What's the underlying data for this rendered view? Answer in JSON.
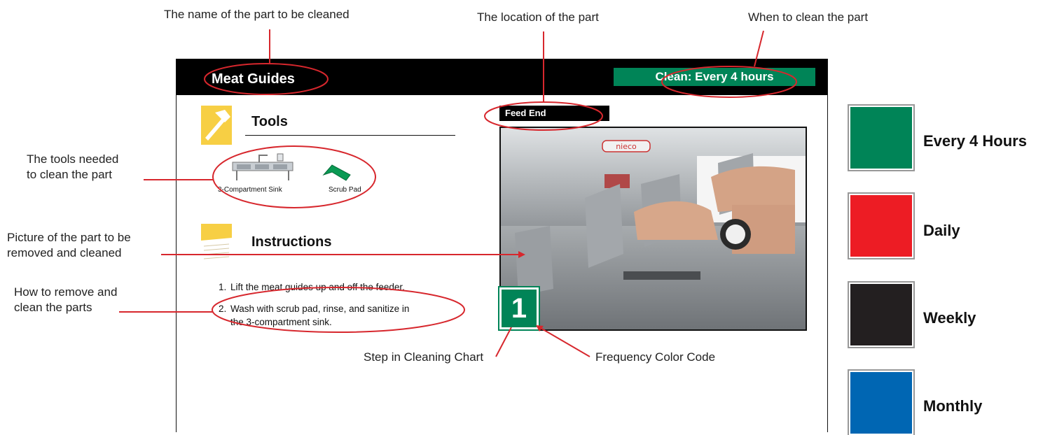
{
  "callouts": {
    "part_name": "The name of the part to be cleaned",
    "location": "The location of the part",
    "when": "When to clean the part",
    "tools_line1": "The tools needed",
    "tools_line2": "to clean the part",
    "picture_line1": "Picture of the part to be",
    "picture_line2": "removed and cleaned",
    "how_line1": "How to remove and",
    "how_line2": "clean the parts",
    "step": "Step in Cleaning Chart",
    "frequency": "Frequency Color Code"
  },
  "card": {
    "title": "Meat Guides",
    "frequency_label": "Clean: Every 4 hours",
    "tools_title": "Tools",
    "tool_items": [
      "3-Compartment Sink",
      "Scrub Pad"
    ],
    "instructions_title": "Instructions",
    "instructions": [
      "Lift the meat guides up and off the feeder.",
      "Wash with scrub pad, rinse, and sanitize in",
      "the 3-compartment sink."
    ],
    "instruction_numbers": [
      "1.",
      "2."
    ],
    "location_label": "Feed End",
    "step_number": "1",
    "photo_brand": "nieco"
  },
  "legend": [
    {
      "label": "Every 4 Hours",
      "color": "#008457"
    },
    {
      "label": "Daily",
      "color": "#ed1c24"
    },
    {
      "label": "Weekly",
      "color": "#231f20"
    },
    {
      "label": "Monthly",
      "color": "#0066b3"
    }
  ],
  "colors": {
    "annotation": "#d7272d",
    "accent_green": "#008457",
    "icon_yellow": "#f7cf44"
  }
}
